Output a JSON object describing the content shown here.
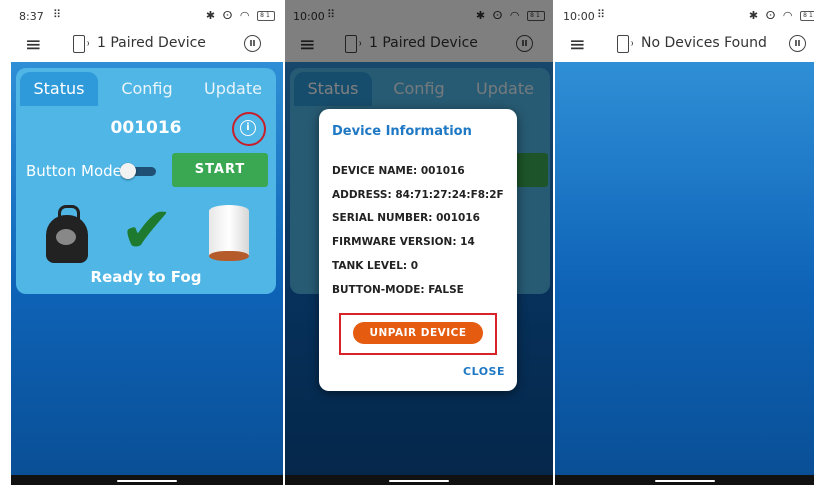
{
  "colors": {
    "background_top": "#2f8fd6",
    "background_bottom": "#0a4f96",
    "card": "#4fb6e6",
    "start_button": "#3aa853",
    "unpair_button": "#e55b10",
    "highlight": "#d9232b",
    "dialog_accent": "#1f78c4"
  },
  "icons": {
    "menu": "≡",
    "pause": "II",
    "info": "i",
    "check": "✔",
    "bluetooth": "✱",
    "vibrate": "ⵙ",
    "wifi": "◠",
    "grid": "⠿"
  },
  "screen1": {
    "status": {
      "time": "8:37",
      "battery": "81"
    },
    "appbar": {
      "title": "1 Paired Device"
    },
    "tabs": [
      {
        "label": "Status",
        "active": true
      },
      {
        "label": "Config",
        "active": false
      },
      {
        "label": "Update",
        "active": false
      }
    ],
    "device_id": "001016",
    "button_mode_label": "Button Mode",
    "button_mode_on": false,
    "start_label": "START",
    "ready_text": "Ready to Fog"
  },
  "screen2": {
    "status": {
      "time": "10:00",
      "battery": "81"
    },
    "appbar": {
      "title": "1 Paired Device"
    },
    "tabs": [
      {
        "label": "Status"
      },
      {
        "label": "Config"
      },
      {
        "label": "Update"
      }
    ],
    "dialog": {
      "title": "Device Information",
      "rows": [
        "DEVICE NAME: 001016",
        "ADDRESS: 84:71:27:24:F8:2F",
        "SERIAL NUMBER: 001016",
        "FIRMWARE VERSION: 14",
        "TANK LEVEL: 0",
        "BUTTON-MODE: FALSE"
      ],
      "unpair_label": "UNPAIR DEVICE",
      "close_label": "CLOSE"
    }
  },
  "screen3": {
    "status": {
      "time": "10:00",
      "battery": "81"
    },
    "appbar": {
      "title": "No Devices Found"
    }
  }
}
